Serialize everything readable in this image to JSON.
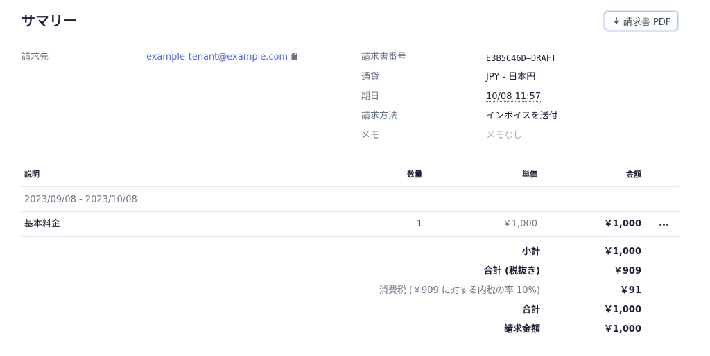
{
  "header": {
    "title": "サマリー",
    "pdf_button_label": "請求書 PDF"
  },
  "info": {
    "bill_to_label": "請求先",
    "bill_to_value": "example-tenant@example.com",
    "invoice_number_label": "請求書番号",
    "invoice_number_value": "E3B5C46D–DRAFT",
    "currency_label": "通貨",
    "currency_value": "JPY - 日本円",
    "due_label": "期日",
    "due_value": "10/08 11:57",
    "method_label": "請求方法",
    "method_value": "インボイスを送付",
    "memo_label": "メモ",
    "memo_value": "メモなし"
  },
  "table": {
    "columns": {
      "description": "説明",
      "quantity": "数量",
      "unit_price": "単価",
      "amount": "金額"
    },
    "period": "2023/09/08 - 2023/10/08",
    "rows": [
      {
        "description": "基本料金",
        "quantity": "1",
        "unit_price": "￥1,000",
        "amount": "￥1,000"
      }
    ]
  },
  "totals": {
    "subtotal_label": "小計",
    "subtotal_value": "￥1,000",
    "total_excl_tax_label": "合計 (税抜き)",
    "total_excl_tax_value": "￥909",
    "tax_label": "消費税 (￥909 に対する内税の率 10%)",
    "tax_value": "￥91",
    "total_label": "合計",
    "total_value": "￥1,000",
    "amount_due_label": "請求金額",
    "amount_due_value": "￥1,000"
  },
  "icons": {
    "download": "arrow-down-icon",
    "copy": "clipboard-icon",
    "more": "more-horizontal-icon"
  },
  "colors": {
    "link": "#5469d4",
    "text": "#1a1f36",
    "muted_label": "#687385",
    "placeholder": "#a3acb9",
    "divider": "#e3e8ee"
  }
}
